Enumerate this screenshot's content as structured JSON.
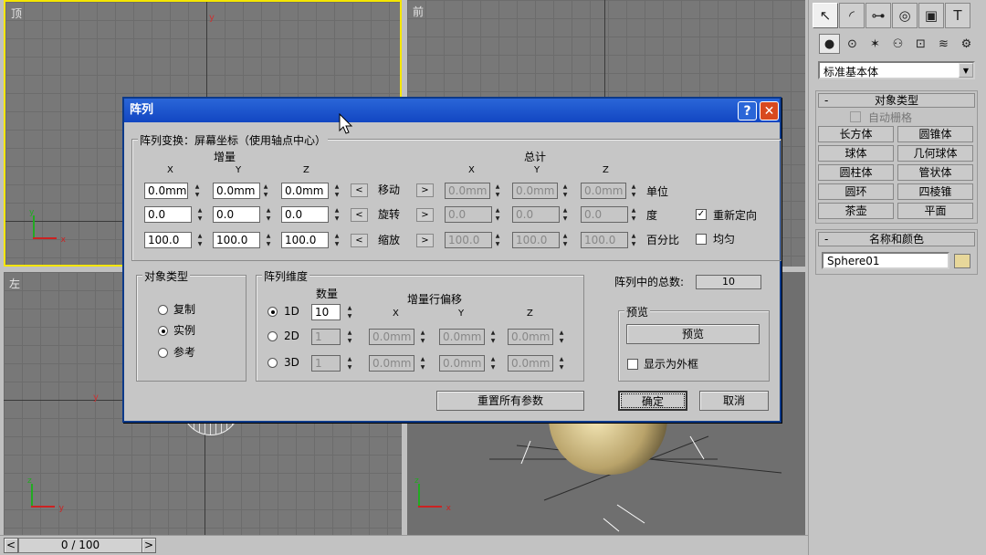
{
  "viewports": {
    "top_label": "顶",
    "front_label": "前",
    "left_label": "左",
    "axis_x": "x",
    "axis_y": "y",
    "axis_z": "z"
  },
  "timeline": {
    "frame": "0 / 100",
    "prev": "<",
    "next": ">"
  },
  "command_panel": {
    "dropdown_value": "标准基本体",
    "object_type_title": "对象类型",
    "auto_grid_label": "自动栅格",
    "objects": [
      "长方体",
      "圆锥体",
      "球体",
      "几何球体",
      "圆柱体",
      "管状体",
      "圆环",
      "四棱锥",
      "茶壶",
      "平面"
    ],
    "name_color_title": "名称和颜色",
    "object_name": "Sphere01",
    "color": "#e7d79a",
    "minus": "-"
  },
  "dialog": {
    "title": "阵列",
    "help_glyph": "?",
    "close_glyph": "✕",
    "transform_group": "阵列变换：屏幕坐标（使用轴点中心）",
    "increment_header": "增量",
    "totals_header": "总计",
    "x": "X",
    "y": "Y",
    "z": "Z",
    "rows": [
      {
        "inc": [
          "0.0mm",
          "0.0mm",
          "0.0mm"
        ],
        "label": "移动",
        "tot": [
          "0.0mm",
          "0.0mm",
          "0.0mm"
        ],
        "unit": "单位"
      },
      {
        "inc": [
          "0.0",
          "0.0",
          "0.0"
        ],
        "label": "旋转",
        "tot": [
          "0.0",
          "0.0",
          "0.0"
        ],
        "unit": "度"
      },
      {
        "inc": [
          "100.0",
          "100.0",
          "100.0"
        ],
        "label": "缩放",
        "tot": [
          "100.0",
          "100.0",
          "100.0"
        ],
        "unit": "百分比"
      }
    ],
    "arrow_left": "<",
    "arrow_right": ">",
    "reorient_label": "重新定向",
    "uniform_label": "均匀",
    "object_type_group": "对象类型",
    "copy_label": "复制",
    "instance_label": "实例",
    "reference_label": "参考",
    "dimensions_group": "阵列维度",
    "count_header": "数量",
    "offset_header": "增量行偏移",
    "dims": [
      {
        "label": "1D",
        "count": "10"
      },
      {
        "label": "2D",
        "count": "1",
        "off": [
          "0.0mm",
          "0.0mm",
          "0.0mm"
        ]
      },
      {
        "label": "3D",
        "count": "1",
        "off": [
          "0.0mm",
          "0.0mm",
          "0.0mm"
        ]
      }
    ],
    "total_label": "阵列中的总数:",
    "total_value": "10",
    "preview_group": "预览",
    "preview_button": "预览",
    "show_box_label": "显示为外框",
    "reset_button": "重置所有参数",
    "ok_button": "确定",
    "cancel_button": "取消",
    "check_mark": "✓"
  }
}
